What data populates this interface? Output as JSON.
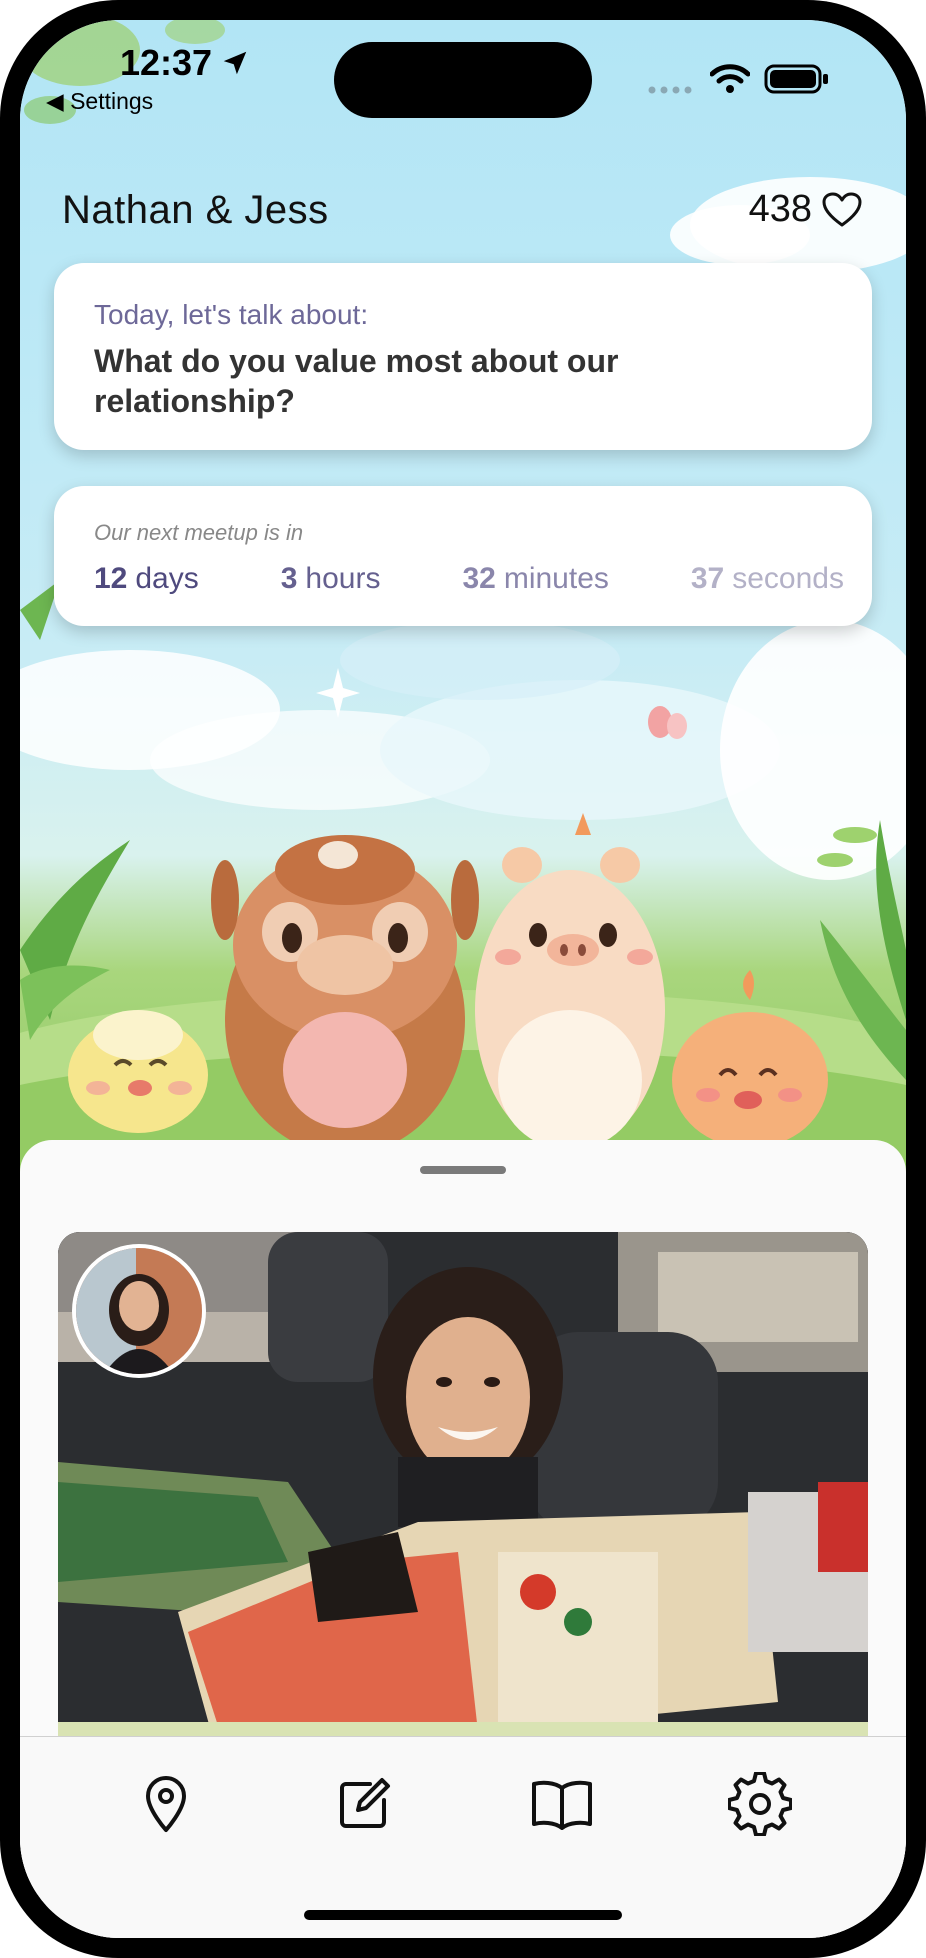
{
  "status_bar": {
    "time": "12:37",
    "back_app": "◀ Settings"
  },
  "header": {
    "title": "Nathan & Jess",
    "heart_count": "438"
  },
  "topic_card": {
    "label": "Today, let's talk about:",
    "question": "What do you value most about our relationship?"
  },
  "meetup_card": {
    "label": "Our next meetup is in",
    "countdown": [
      {
        "value": "12",
        "unit": "days",
        "color": "#4f4a7e"
      },
      {
        "value": "3",
        "unit": "hours",
        "color": "#65608f"
      },
      {
        "value": "32",
        "unit": "minutes",
        "color": "#8a86ab"
      },
      {
        "value": "37",
        "unit": "seconds",
        "color": "#b3b1c7"
      }
    ]
  },
  "tab_bar": {
    "tabs": [
      "map-pin-icon",
      "edit-note-icon",
      "book-icon",
      "settings-gear-icon"
    ]
  },
  "colors": {
    "sky": "#b2e5f5",
    "accent": "#4f4a7e",
    "card_bg": "#ffffff"
  }
}
